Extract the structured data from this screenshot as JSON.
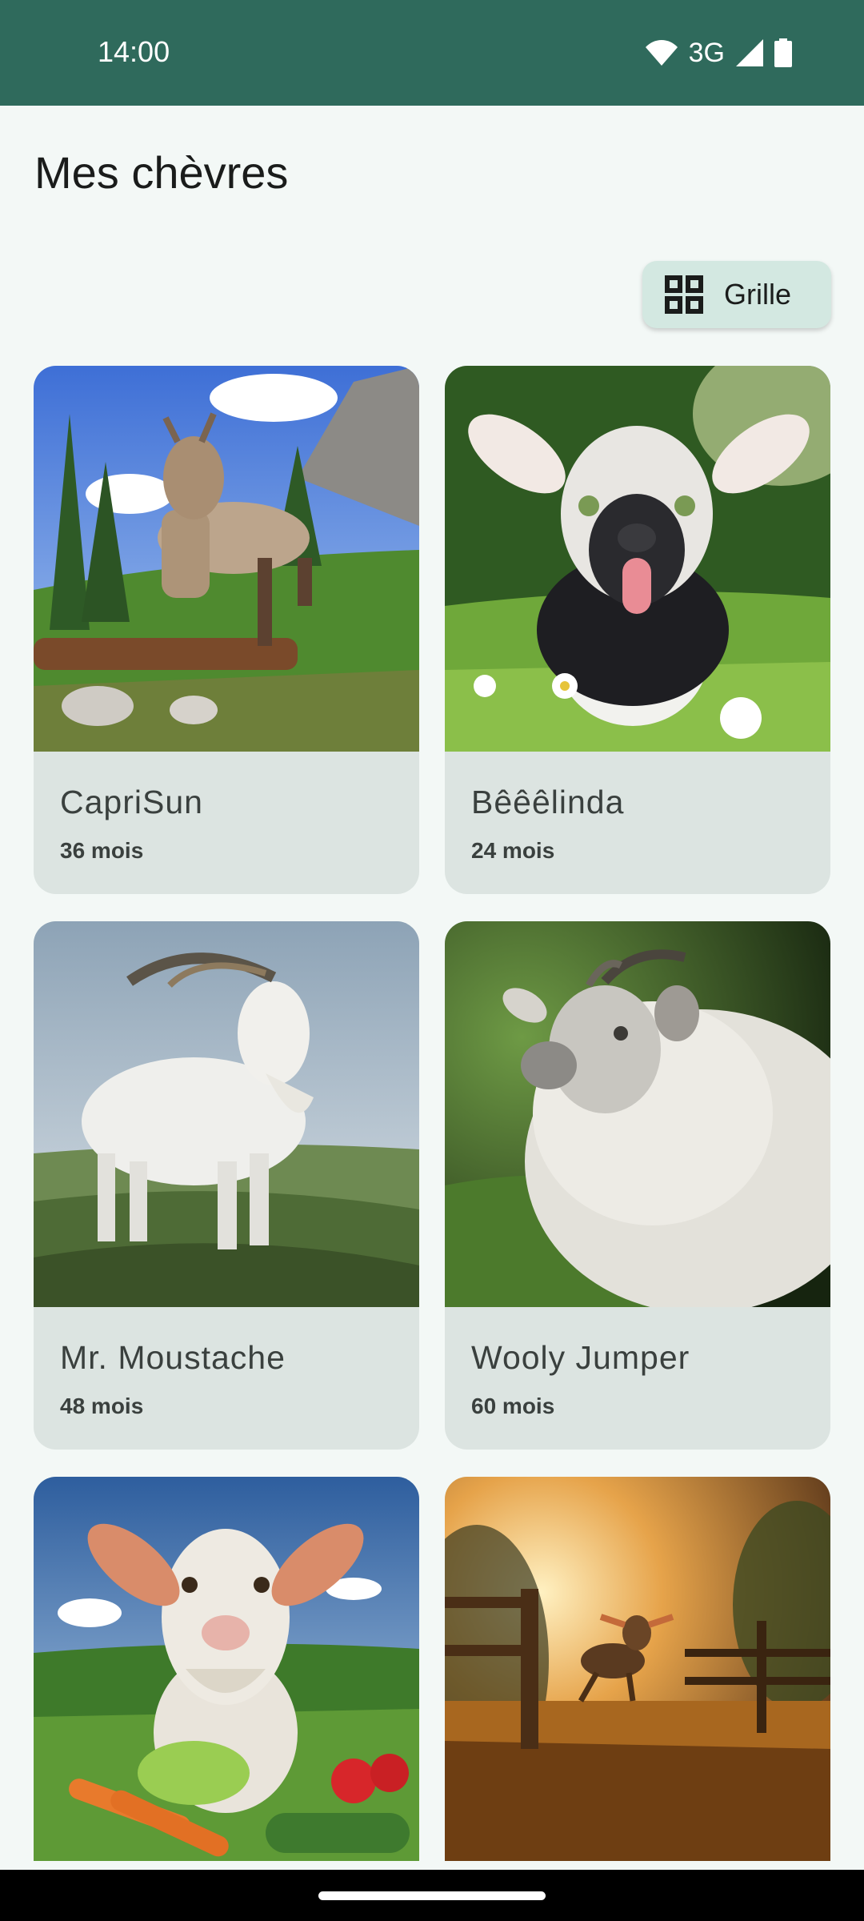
{
  "status_bar": {
    "time": "14:00",
    "network": "3G"
  },
  "page": {
    "title": "Mes chèvres"
  },
  "view_toggle": {
    "label": "Grille",
    "icon": "grid-view-icon"
  },
  "goats": [
    {
      "name": "CapriSun",
      "age": "36 mois"
    },
    {
      "name": "Bêêêlinda",
      "age": "24 mois"
    },
    {
      "name": "Mr. Moustache",
      "age": "48 mois"
    },
    {
      "name": "Wooly Jumper",
      "age": "60 mois"
    },
    {
      "name": "",
      "age": ""
    },
    {
      "name": "",
      "age": ""
    }
  ],
  "colors": {
    "status_bar": "#2F6A5C",
    "background": "#F3F8F6",
    "card": "#DCE4E1",
    "toggle": "#D3E8E1"
  }
}
